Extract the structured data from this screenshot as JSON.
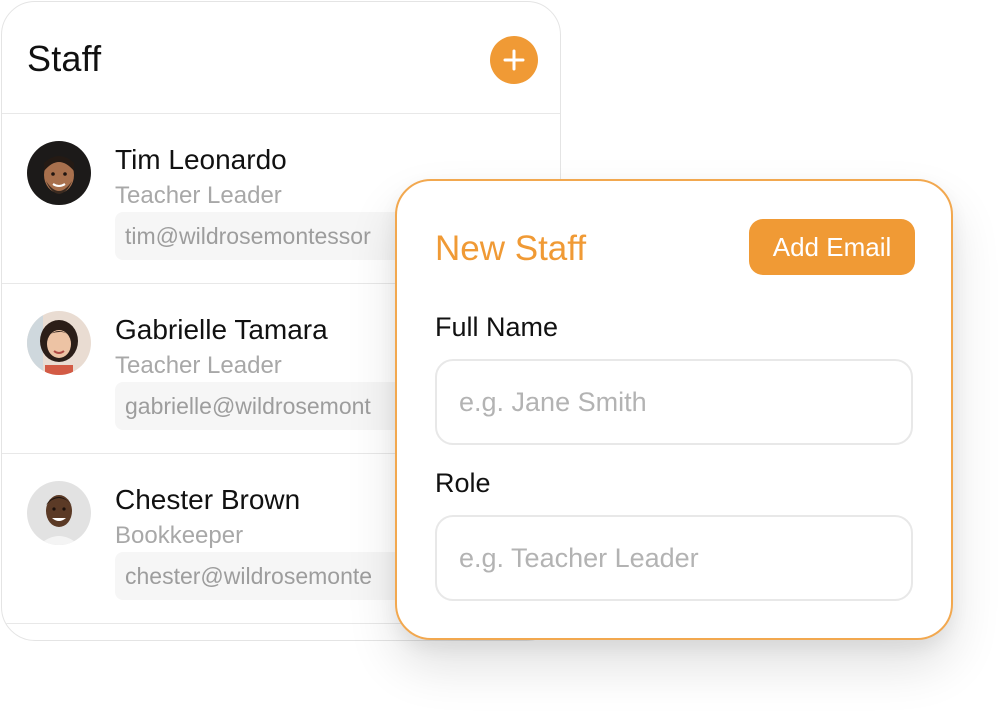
{
  "staff": {
    "title": "Staff",
    "add_button_icon": "plus-icon",
    "members": [
      {
        "name": "Tim Leonardo",
        "role": "Teacher Leader",
        "email": "tim@wildrosemontessor"
      },
      {
        "name": "Gabrielle Tamara",
        "role": "Teacher Leader",
        "email": "gabrielle@wildrosemont"
      },
      {
        "name": "Chester Brown",
        "role": "Bookkeeper",
        "email": "chester@wildrosemonte"
      }
    ]
  },
  "modal": {
    "title": "New Staff",
    "add_email_label": "Add Email",
    "full_name": {
      "label": "Full Name",
      "placeholder": "e.g. Jane Smith",
      "value": ""
    },
    "role": {
      "label": "Role",
      "placeholder": "e.g. Teacher Leader",
      "value": ""
    }
  },
  "colors": {
    "accent": "#f09a35",
    "modal_border": "#f2a84f"
  }
}
